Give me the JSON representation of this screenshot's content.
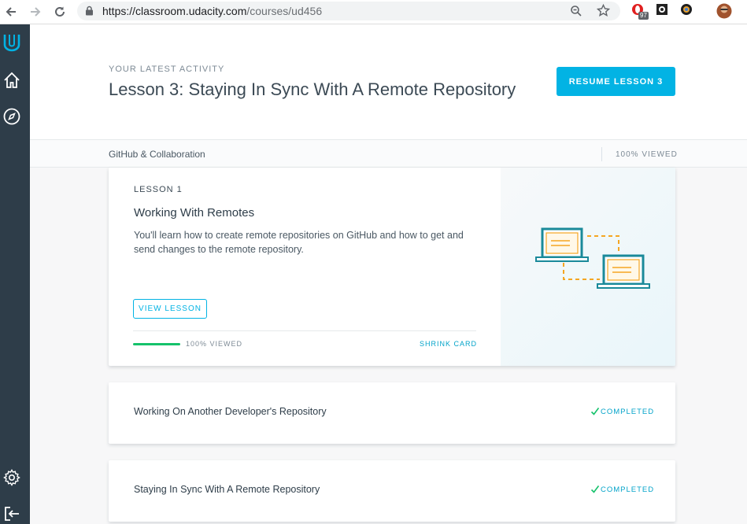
{
  "browser": {
    "url_host": "https://classroom.udacity.com",
    "url_path": "/courses/ud456",
    "extension_badge": "97"
  },
  "header": {
    "eyebrow": "YOUR LATEST ACTIVITY",
    "title": "Lesson 3: Staying In Sync With A Remote Repository",
    "resume_label": "RESUME LESSON 3"
  },
  "subbar": {
    "course_name": "GitHub & Collaboration",
    "viewed_label": "100% VIEWED"
  },
  "expanded_card": {
    "lesson_number": "LESSON 1",
    "title": "Working With Remotes",
    "description": "You'll learn how to create remote repositories on GitHub and how to get and send changes to the remote repository.",
    "view_label": "VIEW LESSON",
    "progress_fraction": 1.0,
    "progress_label": "100% VIEWED",
    "shrink_label": "SHRINK CARD"
  },
  "lesson_rows": [
    {
      "title": "Working On Another Developer's Repository",
      "status": "COMPLETED"
    },
    {
      "title": "Staying In Sync With A Remote Repository",
      "status": "COMPLETED"
    }
  ],
  "colors": {
    "accent": "#02b3e4",
    "rail": "#2e3d49",
    "progress": "#15c26b",
    "illustration_teal": "#1a8a9a",
    "illustration_orange": "#f5a623"
  },
  "icons": {
    "rail": [
      "udacity-logo-icon",
      "home-icon",
      "compass-icon",
      "settings-icon",
      "logout-icon"
    ],
    "chrome": [
      "back-arrow-icon",
      "forward-arrow-icon",
      "reload-icon",
      "lock-icon",
      "zoom-icon",
      "star-icon"
    ]
  }
}
